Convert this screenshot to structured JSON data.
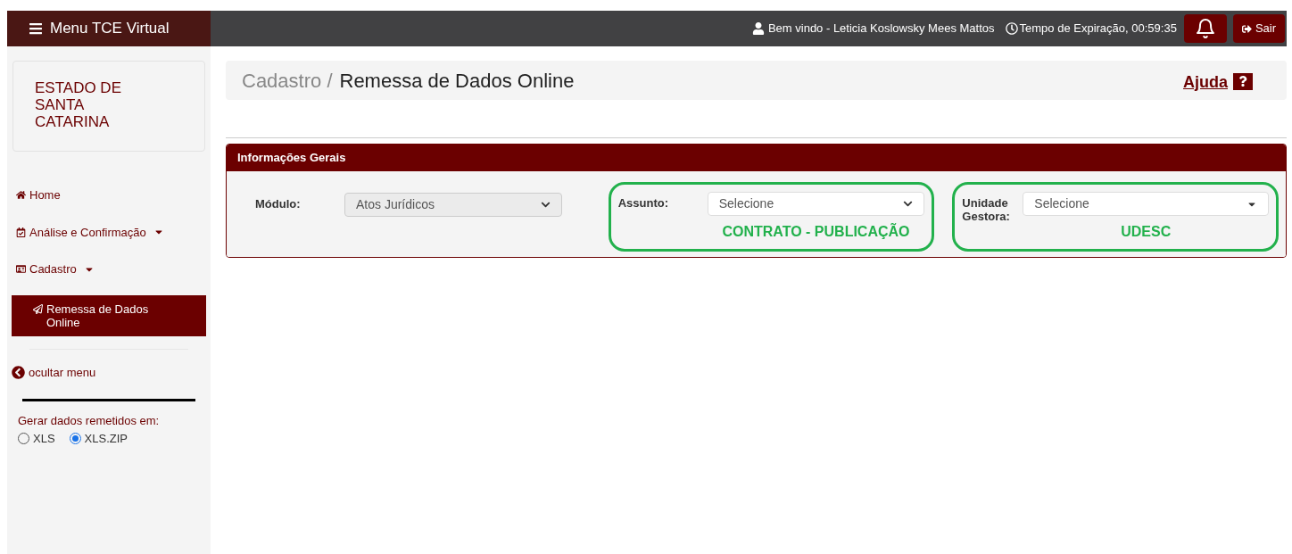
{
  "topbar": {
    "menu_label": "Menu TCE Virtual",
    "welcome": "Bem vindo - Leticia Koslowsky Mees Mattos",
    "expiration": "Tempo de Expiração, 00:59:35",
    "logout": "Sair"
  },
  "sidebar": {
    "entity": "ESTADO DE SANTA CATARINA",
    "items": [
      {
        "kind": "link",
        "label": "Home",
        "selected": false
      },
      {
        "kind": "dropdown",
        "label": "Análise e Confirmação",
        "selected": false
      },
      {
        "kind": "dropdown",
        "label": "Cadastro",
        "selected": false,
        "children": [
          {
            "label": "Remessa de Dados Online",
            "selected": true
          }
        ]
      }
    ],
    "hide_menu": "ocultar menu",
    "export_label": "Gerar dados remetidos em:",
    "export_options": [
      {
        "label": "XLS",
        "selected": false
      },
      {
        "label": "XLS.ZIP",
        "selected": true
      }
    ]
  },
  "breadcrumb": {
    "parent": "Cadastro /",
    "current": "Remessa de Dados Online",
    "help": "Ajuda"
  },
  "panel": {
    "title": "Informações Gerais",
    "fields": [
      {
        "label": "Módulo:",
        "value": "Atos Jurídicos",
        "disabled": true,
        "highlighted": false
      },
      {
        "label": "Assunto:",
        "value": "Selecione",
        "disabled": false,
        "highlighted": true,
        "annotation": "CONTRATO - PUBLICAÇÃO"
      },
      {
        "label": "Unidade Gestora:",
        "value": "Selecione",
        "disabled": false,
        "highlighted": true,
        "annotation": "UDESC"
      }
    ]
  }
}
